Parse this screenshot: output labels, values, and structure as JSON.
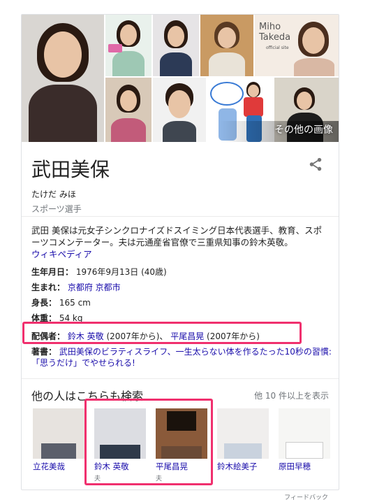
{
  "panel": {
    "name": "武田美保",
    "reading": "たけだ みほ",
    "category": "スポーツ選手",
    "more_images": "その他の画像",
    "photo_logo": {
      "line1": "Miho",
      "line2": "Takeda",
      "line3": "official site"
    }
  },
  "description": {
    "text": "武田 美保は元女子シンクロナイズドスイミング日本代表選手、教育、スポーツコメンテーター。夫は元通産省官僚で三重県知事の鈴木英敬。",
    "source_link": "ウィキペディア"
  },
  "facts": {
    "birth": {
      "label": "生年月日：",
      "value": "1976年9月13日 (40歳)"
    },
    "born": {
      "label": "生まれ：",
      "value": "京都府 京都市"
    },
    "height": {
      "label": "身長：",
      "value": "165 cm"
    },
    "weight": {
      "label": "体重：",
      "value": "54 kg"
    },
    "spouse": {
      "label": "配偶者：",
      "p1": "鈴木 英敬",
      "p1_note": " (2007年から)、",
      "p2": "平尾昌晃",
      "p2_note": " (2007年から)"
    },
    "books": {
      "label": "著書：",
      "value": "武田美保のビラティスライフ、一生太らない体を作るたった10秒の習慣: 「思うだけ」でやせられる!"
    }
  },
  "related": {
    "title": "他の人はこちらも検索",
    "more": "他 10 件以上を表示",
    "people": [
      {
        "name": "立花美哉",
        "rel": ""
      },
      {
        "name": "鈴木 英敬",
        "rel": "夫"
      },
      {
        "name": "平尾昌晃",
        "rel": "夫"
      },
      {
        "name": "鈴木絵美子",
        "rel": ""
      },
      {
        "name": "原田早穂",
        "rel": ""
      }
    ]
  },
  "footer": {
    "feedback": "フィードバック"
  },
  "colors": {
    "link": "#1a0dab",
    "highlight": "#f0306e",
    "muted": "#70757a"
  },
  "icons": {
    "share": "share-icon"
  }
}
